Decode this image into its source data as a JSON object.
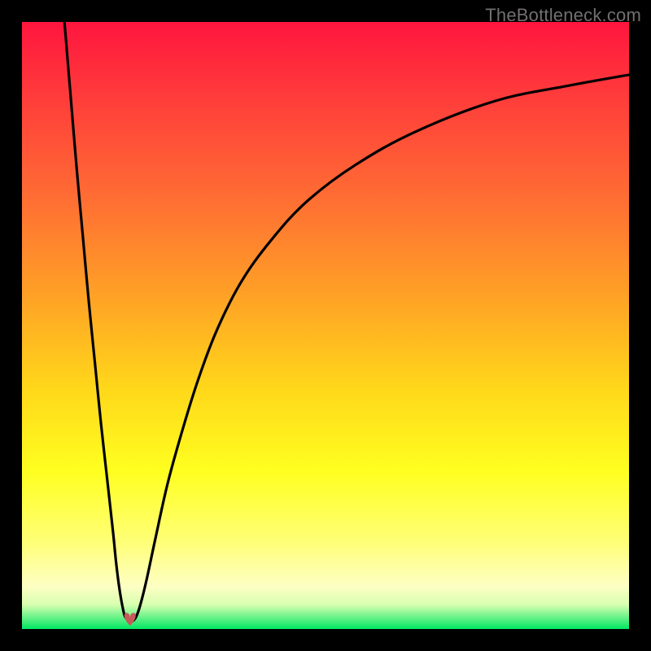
{
  "watermark": "TheBottleneck.com",
  "chart_data": {
    "type": "line",
    "title": "",
    "xlabel": "",
    "ylabel": "",
    "xlim": [
      0,
      100
    ],
    "ylim": [
      0,
      100
    ],
    "grid": false,
    "legend": false,
    "series": [
      {
        "name": "bottleneck-curve",
        "x": [
          7.0,
          8.0,
          9.0,
          10.0,
          11.0,
          12.0,
          13.0,
          14.0,
          15.0,
          15.5,
          16.0,
          16.5,
          17.0,
          17.8,
          18.2,
          18.8,
          19.5,
          20.5,
          22.0,
          24.0,
          26.5,
          29.0,
          32.0,
          36.0,
          41.0,
          47.0,
          55.0,
          65.0,
          78.0,
          90.0,
          100.0
        ],
        "values": [
          100.0,
          88.0,
          76.0,
          65.0,
          54.0,
          44.0,
          34.0,
          25.0,
          16.0,
          11.0,
          7.0,
          4.0,
          2.0,
          1.3,
          1.3,
          2.0,
          4.0,
          8.0,
          15.0,
          24.0,
          33.0,
          41.0,
          49.0,
          57.0,
          64.0,
          70.5,
          76.5,
          82.0,
          87.0,
          89.5,
          91.3
        ]
      }
    ],
    "markers": [
      {
        "name": "heart-marker",
        "x": 17.8,
        "y": 1.3,
        "symbol": "heart",
        "color": "#c45b5b"
      }
    ],
    "background_gradient": {
      "direction": "vertical",
      "stops": [
        {
          "pos": 0.0,
          "color": "#ff153e"
        },
        {
          "pos": 0.5,
          "color": "#ffb020"
        },
        {
          "pos": 0.8,
          "color": "#ffff40"
        },
        {
          "pos": 1.0,
          "color": "#00e763"
        }
      ]
    }
  }
}
